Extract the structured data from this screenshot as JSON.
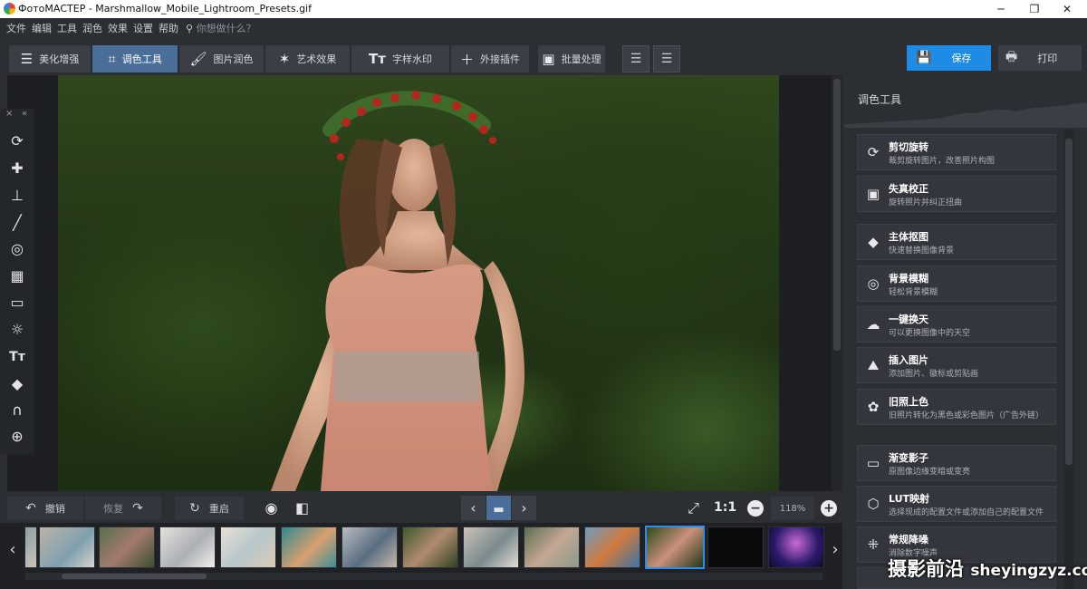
{
  "window": {
    "title": "ФотоМАСТЕР - Marshmallow_Mobile_Lightroom_Presets.gif",
    "minimize_icon": "minimize-icon",
    "maximize_icon": "maximize-icon",
    "close_icon": "close-icon"
  },
  "menu": {
    "items": [
      "文件",
      "编辑",
      "工具",
      "润色",
      "效果",
      "设置",
      "帮助"
    ],
    "search_placeholder": "你想做什么？"
  },
  "toolbar": {
    "tabs": [
      {
        "label": "美化增强",
        "icon": "sliders-icon"
      },
      {
        "label": "调色工具",
        "icon": "crop-icon"
      },
      {
        "label": "图片润色",
        "icon": "brush-icon"
      },
      {
        "label": "艺术效果",
        "icon": "magic-wand-icon"
      },
      {
        "label": "字样水印",
        "icon": "text-icon"
      },
      {
        "label": "外接插件",
        "icon": "plus-icon"
      },
      {
        "label": "批量处理",
        "icon": "images-icon"
      }
    ],
    "active_tab": "调色工具",
    "save_label": "保存",
    "print_label": "打印"
  },
  "left_tools": {
    "collapse_labels": [
      "×",
      "«"
    ],
    "icons": [
      "rotate-crop-icon",
      "bandage-icon",
      "stamp-icon",
      "brush-icon",
      "radial-icon",
      "gradient-icon",
      "vignette-icon",
      "light-icon",
      "text-icon",
      "fill-icon",
      "magnet-icon",
      "lasso-icon"
    ]
  },
  "bottom_bar": {
    "undo_label": "撤销",
    "redo_label": "恢复",
    "reset_label": "重启",
    "zoom_1_1": "1:1",
    "zoom_value": "118%"
  },
  "right_panel": {
    "title": "调色工具",
    "cards": [
      {
        "title": "剪切旋转",
        "desc": "裁剪旋转图片，改善照片构图",
        "icon": "crop-rotate-icon"
      },
      {
        "title": "失真校正",
        "desc": "旋转照片并纠正扭曲",
        "icon": "distortion-icon"
      },
      {
        "title": "主体抠图",
        "desc": "快速替换图像背景",
        "icon": "cutout-icon"
      },
      {
        "title": "背景模糊",
        "desc": "轻松背景模糊",
        "icon": "blur-icon"
      },
      {
        "title": "一键换天",
        "desc": "可以更换图像中的天空",
        "icon": "sky-icon"
      },
      {
        "title": "插入图片",
        "desc": "添加图片、徽标或剪贴画",
        "icon": "insert-image-icon"
      },
      {
        "title": "旧照上色",
        "desc": "旧照片转化为黑色或彩色图片（广告外链）",
        "icon": "colorize-icon"
      },
      {
        "title": "渐变影子",
        "desc": "原图像边缘变暗或变亮",
        "icon": "vignette-icon"
      },
      {
        "title": "LUT映射",
        "desc": "选择现成的配置文件或添加自己的配置文件",
        "icon": "lut-icon"
      },
      {
        "title": "常规降噪",
        "desc": "消除数字噪声",
        "icon": "denoise-icon"
      }
    ]
  },
  "watermark": {
    "text": "摄影前沿",
    "url": "sheyingzyz.com"
  },
  "colors": {
    "accent": "#1e8ce5",
    "active_tab": "#4a6e98",
    "background": "#2b2e33"
  }
}
